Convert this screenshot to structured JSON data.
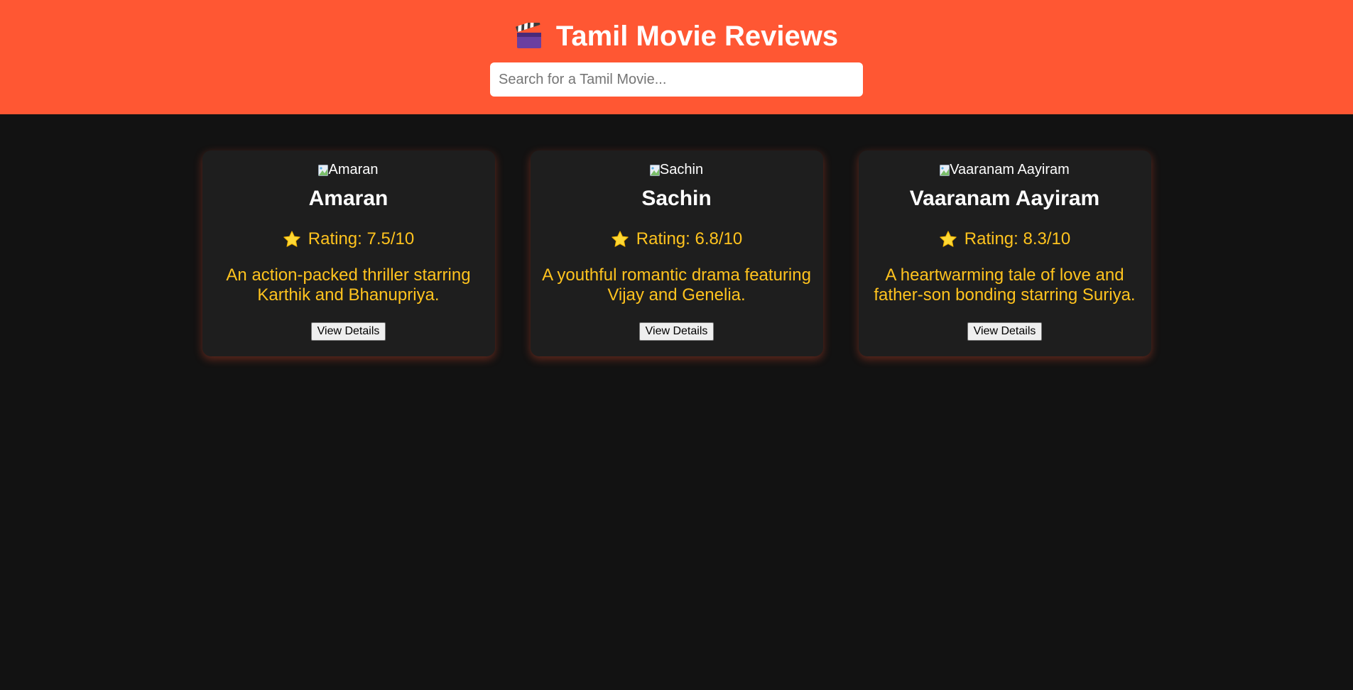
{
  "header": {
    "title": "Tamil Movie Reviews",
    "icon": "clapperboard-icon",
    "background": "#ff5733"
  },
  "search": {
    "placeholder": "Search for a Tamil Movie...",
    "value": ""
  },
  "movies": [
    {
      "poster_alt": "Amaran",
      "title": "Amaran",
      "rating": "Rating: 7.5/10",
      "description": "An action-packed thriller starring Karthik and Bhanupriya.",
      "button": "View Details"
    },
    {
      "poster_alt": "Sachin",
      "title": "Sachin",
      "rating": "Rating: 6.8/10",
      "description": "A youthful romantic drama featuring Vijay and Genelia.",
      "button": "View Details"
    },
    {
      "poster_alt": "Vaaranam Aayiram",
      "title": "Vaaranam Aayiram",
      "rating": "Rating: 8.3/10",
      "description": "A heartwarming tale of love and father-son bonding starring Suriya.",
      "button": "View Details"
    }
  ],
  "colors": {
    "page_background": "#121212",
    "card_background": "#1e1e1e",
    "accent_text": "#ffc31e"
  }
}
